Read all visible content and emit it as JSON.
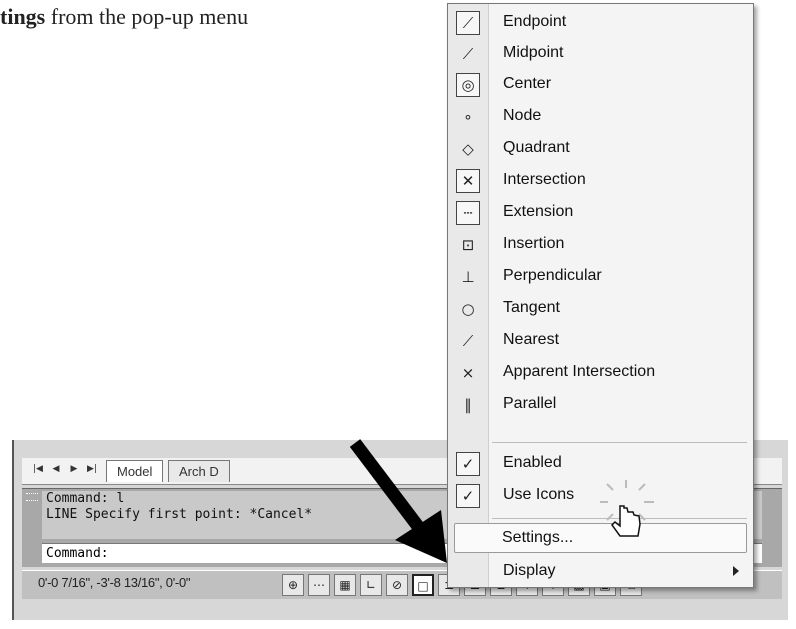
{
  "instruction": {
    "bold": "tings",
    "rest": " from the pop-up menu"
  },
  "menu": {
    "snap_items": [
      {
        "label": "Endpoint",
        "icon": "endpoint-icon"
      },
      {
        "label": "Midpoint",
        "icon": "midpoint-icon"
      },
      {
        "label": "Center",
        "icon": "center-icon"
      },
      {
        "label": "Node",
        "icon": "node-icon"
      },
      {
        "label": "Quadrant",
        "icon": "quadrant-icon"
      },
      {
        "label": "Intersection",
        "icon": "intersection-icon"
      },
      {
        "label": "Extension",
        "icon": "extension-icon"
      },
      {
        "label": "Insertion",
        "icon": "insertion-icon"
      },
      {
        "label": "Perpendicular",
        "icon": "perpendicular-icon"
      },
      {
        "label": "Tangent",
        "icon": "tangent-icon"
      },
      {
        "label": "Nearest",
        "icon": "nearest-icon"
      },
      {
        "label": "Apparent Intersection",
        "icon": "apparent-intersection-icon"
      },
      {
        "label": "Parallel",
        "icon": "parallel-icon"
      }
    ],
    "enabled_label": "Enabled",
    "use_icons_label": "Use Icons",
    "settings_label": "Settings...",
    "display_label": "Display",
    "checkmark": "✓"
  },
  "layout_tabs": {
    "model": "Model",
    "arch": "Arch D"
  },
  "command": {
    "history_1": "Command: l",
    "history_2": "LINE Specify first point: *Cancel*",
    "prompt": "Command:"
  },
  "status": {
    "coords": "0'-0 7/16\",  -3'-8 13/16\", 0'-0\""
  }
}
